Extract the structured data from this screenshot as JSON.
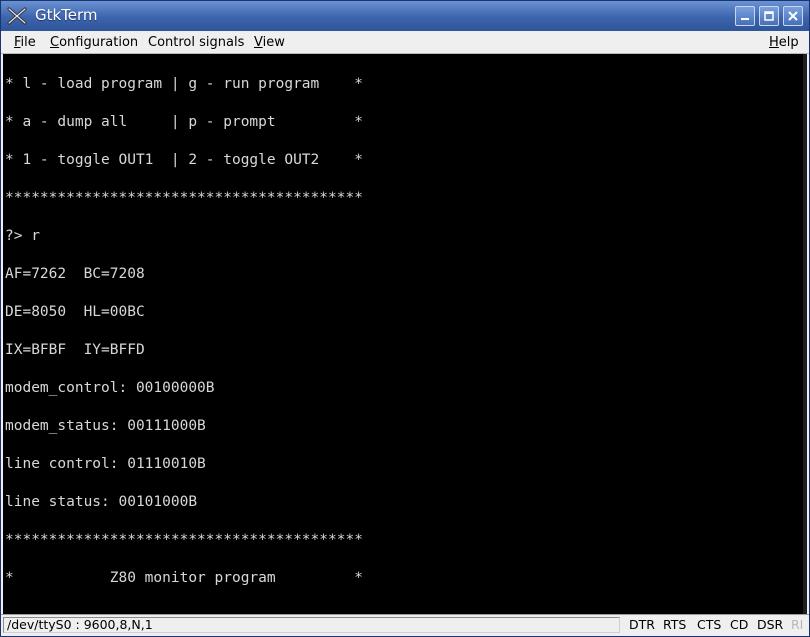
{
  "window": {
    "title": "GtkTerm",
    "controls": {
      "minimize": "minimize",
      "maximize": "maximize",
      "close": "close"
    }
  },
  "menubar": {
    "file": {
      "accel": "F",
      "rest": "ile"
    },
    "configuration": {
      "accel": "C",
      "rest": "onfiguration"
    },
    "control_signals": {
      "label": "Control signals"
    },
    "view": {
      "accel": "V",
      "rest": "iew"
    },
    "help": {
      "accel": "H",
      "rest": "elp"
    }
  },
  "terminal": {
    "lines": [
      "* l - load program | g - run program    *",
      "* a - dump all     | p - prompt         *",
      "* 1 - toggle OUT1  | 2 - toggle OUT2    *",
      "*****************************************",
      "?> r",
      "AF=7262  BC=7208",
      "DE=8050  HL=00BC",
      "IX=BFBF  IY=BFFD",
      "modem_control: 00100000B",
      "modem_status: 00111000B",
      "line control: 01110010B",
      "line status: 00101000B",
      "*****************************************",
      "*           Z80 monitor program         *"
    ]
  },
  "statusbar": {
    "port": "/dev/ttyS0 : 9600,8,N,1",
    "signals": [
      {
        "label": "DTR",
        "active": true
      },
      {
        "label": "RTS",
        "active": true
      },
      {
        "label": "CTS",
        "active": true
      },
      {
        "label": "CD",
        "active": true
      },
      {
        "label": "DSR",
        "active": true
      },
      {
        "label": "RI",
        "active": false
      }
    ]
  },
  "colors": {
    "titlebar": "#3c64ad",
    "terminal_bg": "#000000",
    "terminal_fg": "#d8d8d8",
    "inactive_signal": "#b8b8b8"
  }
}
